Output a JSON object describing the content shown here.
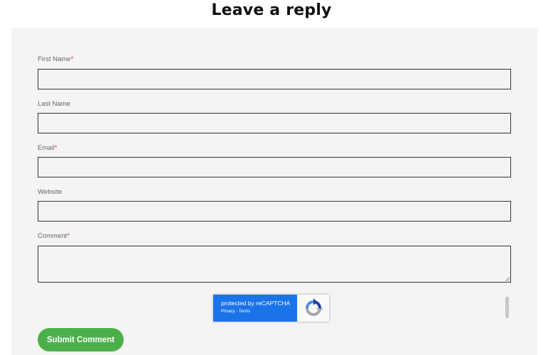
{
  "heading": "Leave a reply",
  "form": {
    "required_mark": "*",
    "first_name": {
      "label": "First Name",
      "value": ""
    },
    "last_name": {
      "label": "Last Name",
      "value": ""
    },
    "email": {
      "label": "Email",
      "value": ""
    },
    "website": {
      "label": "Website",
      "value": ""
    },
    "comment": {
      "label": "Comment",
      "value": ""
    },
    "submit_label": "Submit Comment"
  },
  "recaptcha": {
    "title": "protected by reCAPTCHA",
    "privacy": "Privacy",
    "separator": " - ",
    "terms": "Terms",
    "icon": "recaptcha-logo-icon"
  },
  "colors": {
    "panel_bg": "#f4f4f4",
    "required": "#d23b3b",
    "submit_bg": "#4cb04a",
    "captcha_blue": "#1a73e8"
  }
}
